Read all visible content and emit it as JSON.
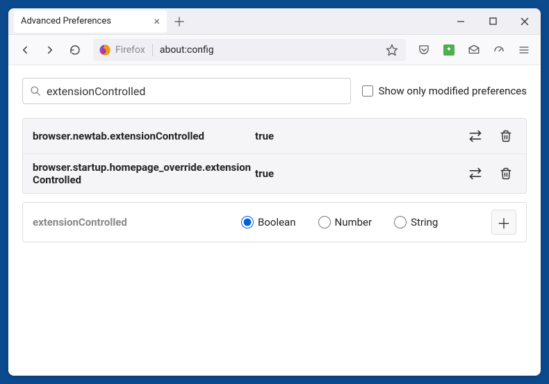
{
  "tab": {
    "title": "Advanced Preferences"
  },
  "urlbar": {
    "protocol": "Firefox",
    "address": "about:config"
  },
  "search": {
    "value": "extensionControlled",
    "checkbox_label": "Show only modified preferences"
  },
  "prefs": {
    "rows": [
      {
        "name": "browser.newtab.extensionControlled",
        "value": "true"
      },
      {
        "name": "browser.startup.homepage_override.extensionControlled",
        "value": "true"
      }
    ]
  },
  "newpref": {
    "name": "extensionControlled",
    "types": {
      "boolean": "Boolean",
      "number": "Number",
      "string": "String"
    }
  }
}
